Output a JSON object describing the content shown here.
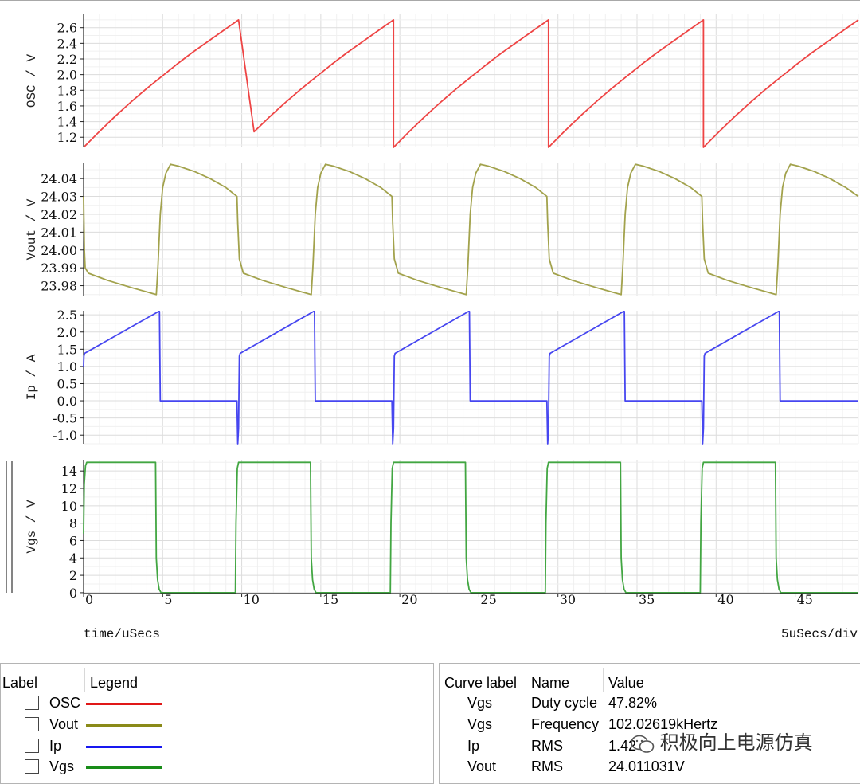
{
  "chart_data": {
    "type": "line",
    "x_unit_label": "time/uSecs",
    "x_div_label": "5uSecs/div",
    "xlim": [
      0,
      49
    ],
    "x_ticks": [
      0,
      5,
      10,
      15,
      20,
      25,
      30,
      35,
      40,
      45
    ],
    "grid": true,
    "period_us": 9.8,
    "panels": [
      {
        "name": "OSC",
        "ylabel": "OSC / V",
        "color": "#ee4444",
        "ylim": [
          1.07,
          2.77
        ],
        "y_ticks": [
          1.2,
          1.4,
          1.6,
          1.8,
          2.0,
          2.2,
          2.4,
          2.6
        ],
        "y_tick_labels": [
          "1.2",
          "1.4",
          "1.6",
          "1.8",
          "2.0",
          "2.2",
          "2.4",
          "2.6"
        ],
        "series": [
          {
            "x": [
              0,
              0.98,
              1.96,
              2.94,
              3.92,
              4.9,
              5.88,
              6.86,
              7.84,
              8.82,
              9.6,
              9.8,
              9.8,
              10.78,
              11.76,
              12.74,
              13.72,
              14.7,
              15.68,
              16.66,
              17.64,
              18.62,
              19.4,
              19.6,
              19.6,
              20.58,
              21.56,
              22.54,
              23.52,
              24.5,
              25.48,
              26.46,
              27.44,
              28.42,
              29.2,
              29.4,
              29.4,
              30.38,
              31.36,
              32.34,
              33.32,
              34.3,
              35.28,
              36.26,
              37.24,
              38.22,
              39.0,
              39.2,
              39.2,
              40.18,
              41.16,
              42.14,
              43.12,
              44.1,
              45.08,
              46.06,
              47.04,
              48.02,
              48.8,
              49.0
            ],
            "y": [
              1.07,
              1.27,
              1.46,
              1.64,
              1.81,
              1.97,
              2.13,
              2.28,
              2.42,
              2.56,
              2.67,
              2.7,
              2.7,
              1.27,
              1.46,
              1.64,
              1.81,
              1.97,
              2.13,
              2.28,
              2.42,
              2.56,
              2.67,
              2.7,
              1.07,
              1.27,
              1.46,
              1.64,
              1.81,
              1.97,
              2.13,
              2.28,
              2.42,
              2.56,
              2.67,
              2.7,
              1.07,
              1.27,
              1.46,
              1.64,
              1.81,
              1.97,
              2.13,
              2.28,
              2.42,
              2.56,
              2.67,
              2.7,
              1.07,
              1.27,
              1.46,
              1.64,
              1.81,
              1.97,
              2.13,
              2.28,
              2.42,
              2.56,
              2.67,
              2.7
            ]
          }
        ]
      },
      {
        "name": "Vout",
        "ylabel": "Vout / V",
        "color": "#a2a24c",
        "ylim": [
          23.974,
          24.049
        ],
        "y_ticks": [
          23.98,
          23.99,
          24.0,
          24.01,
          24.02,
          24.03,
          24.04
        ],
        "y_tick_labels": [
          "23.98",
          "23.99",
          "24.00",
          "24.01",
          "24.02",
          "24.03",
          "24.04"
        ],
        "series": [
          {
            "x": [
              0,
              0.05,
              0.1,
              0.3,
              1.5,
              3.0,
              4.6,
              4.7,
              4.85,
              5.0,
              5.2,
              5.5,
              6.0,
              7.0,
              8.0,
              9.0,
              9.7,
              9.75,
              9.85,
              10.1,
              11.3,
              12.8,
              14.4,
              14.5,
              14.65,
              14.8,
              15.0,
              15.3,
              15.8,
              16.8,
              17.8,
              18.8,
              19.5,
              19.55,
              19.65,
              19.9,
              21.1,
              22.6,
              24.2,
              24.3,
              24.45,
              24.6,
              24.8,
              25.1,
              25.6,
              26.6,
              27.6,
              28.6,
              29.3,
              29.35,
              29.45,
              29.7,
              30.9,
              32.4,
              34.0,
              34.1,
              34.25,
              34.4,
              34.6,
              34.9,
              35.4,
              36.4,
              37.4,
              38.4,
              39.1,
              39.15,
              39.25,
              39.5,
              40.7,
              42.2,
              43.8,
              43.9,
              44.05,
              44.2,
              44.4,
              44.7,
              45.2,
              46.2,
              47.2,
              48.2,
              49.0
            ],
            "y": [
              24.03,
              24.0,
              23.99,
              23.987,
              23.983,
              23.979,
              23.975,
              23.99,
              24.02,
              24.035,
              24.043,
              24.048,
              24.047,
              24.044,
              24.04,
              24.035,
              24.03,
              24.015,
              23.995,
              23.987,
              23.983,
              23.979,
              23.975,
              23.99,
              24.02,
              24.035,
              24.043,
              24.048,
              24.047,
              24.044,
              24.04,
              24.035,
              24.03,
              24.015,
              23.995,
              23.987,
              23.983,
              23.979,
              23.975,
              23.99,
              24.02,
              24.035,
              24.043,
              24.048,
              24.047,
              24.044,
              24.04,
              24.035,
              24.03,
              24.015,
              23.995,
              23.987,
              23.983,
              23.979,
              23.975,
              23.99,
              24.02,
              24.035,
              24.043,
              24.048,
              24.047,
              24.044,
              24.04,
              24.035,
              24.03,
              24.015,
              23.995,
              23.987,
              23.983,
              23.979,
              23.975,
              23.99,
              24.02,
              24.035,
              24.043,
              24.048,
              24.047,
              24.044,
              24.04,
              24.035,
              24.03
            ]
          }
        ]
      },
      {
        "name": "Ip",
        "ylabel": "Ip / A",
        "color": "#4646f0",
        "ylim": [
          -1.25,
          2.62
        ],
        "y_ticks": [
          -1.0,
          -0.5,
          0.0,
          0.5,
          1.0,
          1.5,
          2.0,
          2.5
        ],
        "y_tick_labels": [
          "-1.0",
          "-0.5",
          "0.0",
          "0.5",
          "1.0",
          "1.5",
          "2.0",
          "2.5"
        ],
        "series": [
          {
            "x": [
              0,
              0.02,
              0.06,
              4.75,
              4.8,
              4.85,
              9.7,
              9.72,
              9.75,
              9.8,
              9.85,
              9.9,
              14.55,
              14.6,
              14.65,
              19.5,
              19.52,
              19.55,
              19.6,
              19.65,
              19.7,
              24.35,
              24.4,
              24.45,
              29.3,
              29.32,
              29.35,
              29.4,
              29.45,
              29.5,
              34.15,
              34.2,
              34.25,
              39.1,
              39.12,
              39.15,
              39.2,
              39.25,
              39.3,
              43.95,
              44.0,
              44.05,
              49.0
            ],
            "y": [
              1.0,
              1.3,
              1.38,
              2.6,
              2.6,
              0.0,
              0.0,
              -0.5,
              -1.25,
              -0.8,
              1.3,
              1.38,
              2.6,
              2.6,
              0.0,
              0.0,
              -0.5,
              -1.25,
              -0.8,
              1.3,
              1.38,
              2.6,
              2.6,
              0.0,
              0.0,
              -0.5,
              -1.25,
              -0.8,
              1.3,
              1.38,
              2.6,
              2.6,
              0.0,
              0.0,
              -0.5,
              -1.25,
              -0.8,
              1.3,
              1.38,
              2.6,
              2.6,
              0.0,
              0.0
            ]
          }
        ]
      },
      {
        "name": "Vgs",
        "ylabel": "Vgs / V",
        "color": "#42a642",
        "ylim": [
          -0.1,
          15.3
        ],
        "y_ticks": [
          0,
          2,
          4,
          6,
          8,
          10,
          12,
          14
        ],
        "y_tick_labels": [
          "0",
          "2",
          "4",
          "6",
          "8",
          "10",
          "12",
          "14"
        ],
        "series": [
          {
            "x": [
              0,
              0.04,
              0.12,
              0.2,
              0.4,
              4.55,
              4.6,
              4.68,
              4.78,
              4.9,
              9.6,
              9.64,
              9.72,
              9.8,
              10.0,
              14.35,
              14.4,
              14.48,
              14.58,
              14.7,
              19.4,
              19.44,
              19.52,
              19.6,
              19.8,
              24.15,
              24.2,
              24.28,
              24.38,
              24.5,
              29.2,
              29.24,
              29.32,
              29.4,
              29.6,
              33.95,
              34.0,
              34.08,
              34.18,
              34.3,
              39.0,
              39.04,
              39.12,
              39.2,
              39.4,
              43.75,
              43.8,
              43.88,
              43.98,
              44.1,
              49.0
            ],
            "y": [
              6.8,
              12.5,
              14.6,
              15.0,
              15.0,
              15.0,
              4.0,
              1.5,
              0.4,
              0.0,
              0.0,
              8.0,
              14.3,
              15.0,
              15.0,
              15.0,
              4.0,
              1.5,
              0.4,
              0.0,
              0.0,
              8.0,
              14.3,
              15.0,
              15.0,
              15.0,
              4.0,
              1.5,
              0.4,
              0.0,
              0.0,
              8.0,
              14.3,
              15.0,
              15.0,
              15.0,
              4.0,
              1.5,
              0.4,
              0.0,
              0.0,
              8.0,
              14.3,
              15.0,
              15.0,
              15.0,
              4.0,
              1.5,
              0.4,
              0.0,
              0.0
            ]
          }
        ]
      }
    ]
  },
  "legend_panel": {
    "header_label": "Label",
    "header_legend": "Legend",
    "items": [
      {
        "label": "OSC",
        "color": "#e01818"
      },
      {
        "label": "Vout",
        "color": "#8a8a18"
      },
      {
        "label": "Ip",
        "color": "#1818f0"
      },
      {
        "label": "Vgs",
        "color": "#188c18"
      }
    ]
  },
  "measure_panel": {
    "header_curve": "Curve label",
    "header_name": "Name",
    "header_value": "Value",
    "rows": [
      {
        "curve": "Vgs",
        "name": "Duty cycle",
        "value": "47.82%"
      },
      {
        "curve": "Vgs",
        "name": "Frequency",
        "value": "102.02619kHertz"
      },
      {
        "curve": "Ip",
        "name": "RMS",
        "value": "1.42"
      },
      {
        "curve": "Vout",
        "name": "RMS",
        "value": "24.011031V"
      }
    ]
  },
  "watermark": "积极向上电源仿真"
}
